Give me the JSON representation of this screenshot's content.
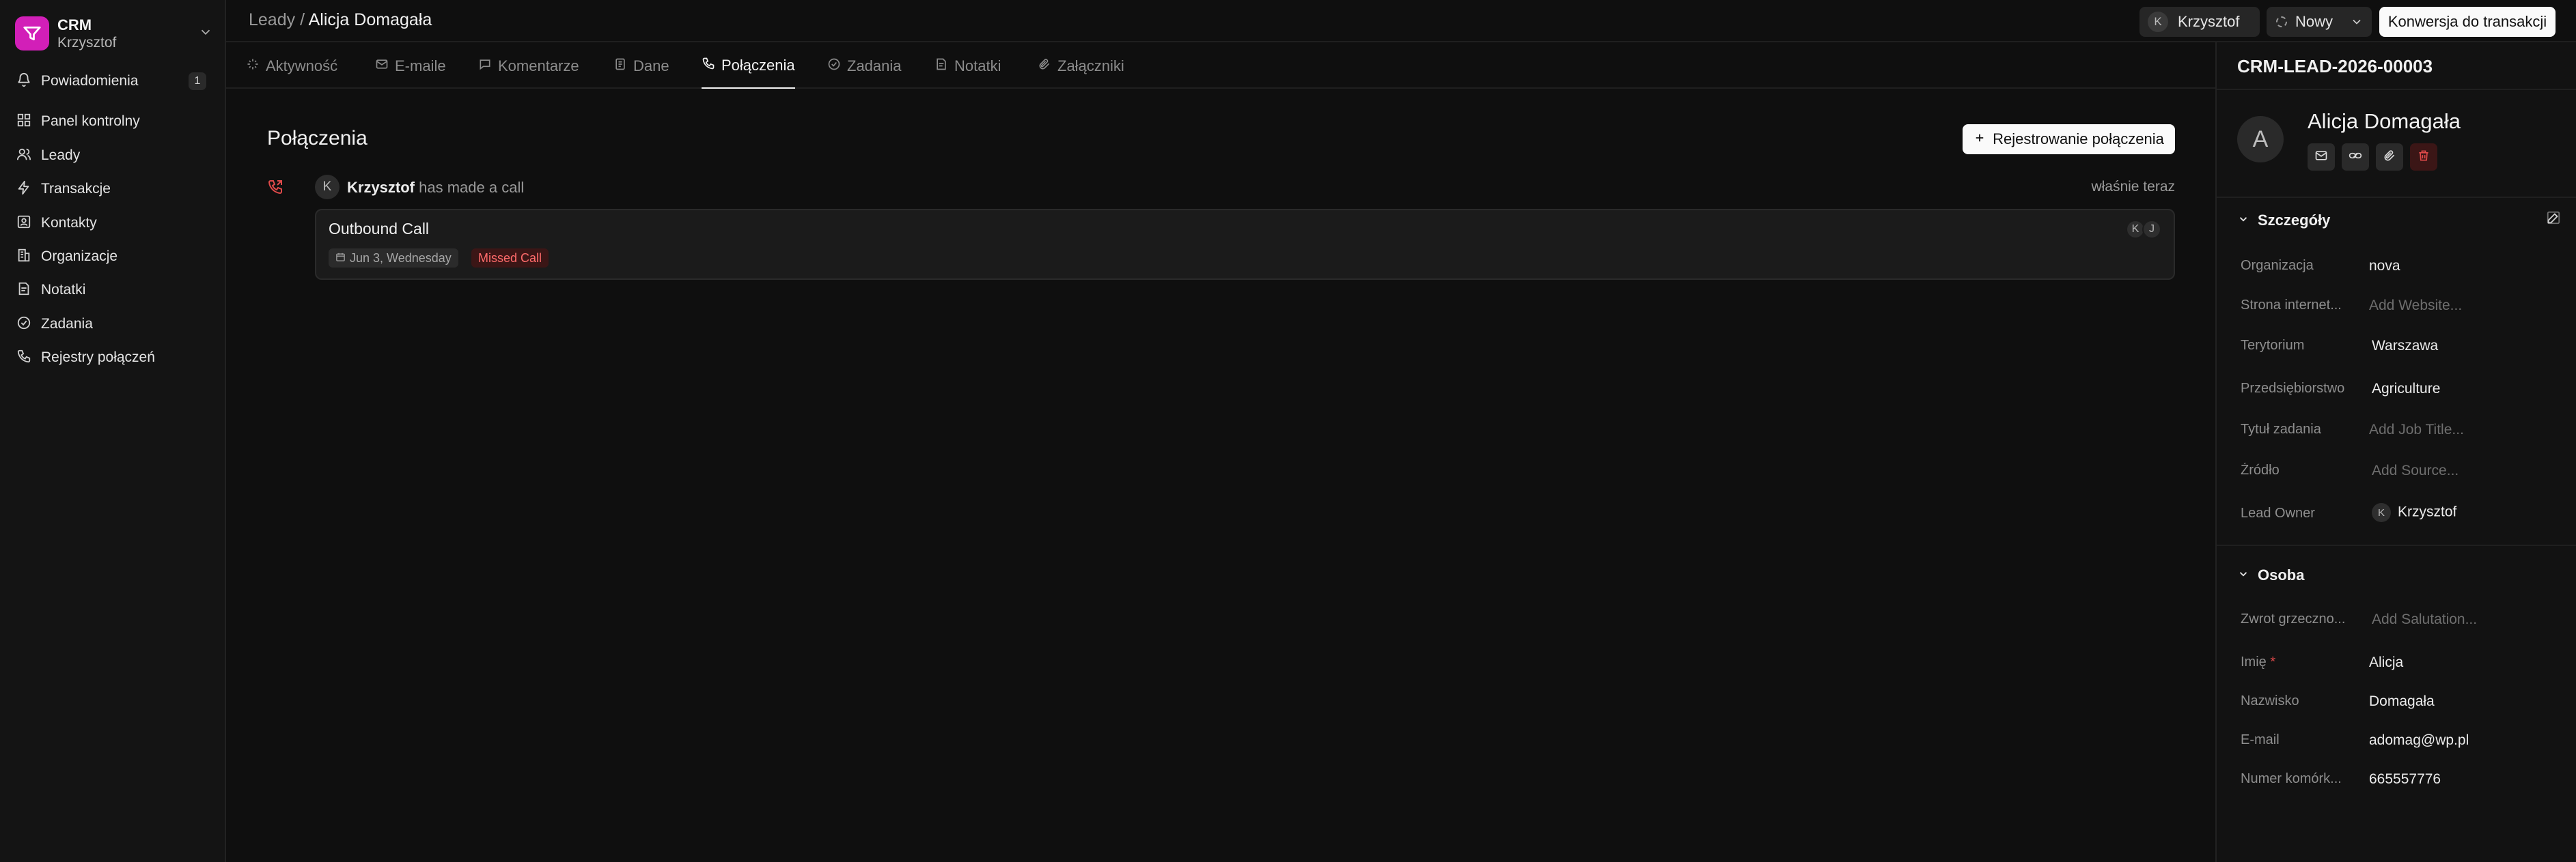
{
  "app": {
    "name": "CRM",
    "user": "Krzysztof"
  },
  "sidebar": {
    "items": [
      {
        "label": "Powiadomienia",
        "icon": "bell-icon",
        "badge": "1"
      },
      {
        "label": "Panel kontrolny",
        "icon": "dashboard-icon"
      },
      {
        "label": "Leady",
        "icon": "users-icon"
      },
      {
        "label": "Transakcje",
        "icon": "lightning-icon"
      },
      {
        "label": "Kontakty",
        "icon": "contact-icon"
      },
      {
        "label": "Organizacje",
        "icon": "building-icon"
      },
      {
        "label": "Notatki",
        "icon": "note-icon"
      },
      {
        "label": "Zadania",
        "icon": "check-circle-icon"
      },
      {
        "label": "Rejestry połączeń",
        "icon": "phone-icon"
      }
    ]
  },
  "breadcrumb": {
    "parent": "Leady",
    "separator": " / ",
    "current": "Alicja Domagała"
  },
  "header": {
    "user_initial": "K",
    "user_name": "Krzysztof",
    "status": "Nowy",
    "convert_label": "Konwersja do transakcji"
  },
  "tabs": [
    {
      "label": "Aktywność",
      "icon": "activity-icon"
    },
    {
      "label": "E-maile",
      "icon": "mail-icon"
    },
    {
      "label": "Komentarze",
      "icon": "comment-icon"
    },
    {
      "label": "Dane",
      "icon": "document-icon"
    },
    {
      "label": "Połączenia",
      "icon": "phone-icon",
      "active": true
    },
    {
      "label": "Zadania",
      "icon": "check-circle-icon"
    },
    {
      "label": "Notatki",
      "icon": "note-icon"
    },
    {
      "label": "Załączniki",
      "icon": "paperclip-icon"
    }
  ],
  "calls": {
    "title": "Połączenia",
    "log_button": "Rejestrowanie połączenia",
    "activity": {
      "initial": "K",
      "actor": "Krzysztof",
      "action": "has made a call",
      "time": "właśnie teraz",
      "card": {
        "title": "Outbound Call",
        "date": "Jun 3, Wednesday",
        "status": "Missed Call",
        "participants": [
          "K",
          "J"
        ]
      }
    }
  },
  "panel": {
    "lead_id": "CRM-LEAD-2026-00003",
    "avatar_initial": "A",
    "name": "Alicja Domagała",
    "details": {
      "title": "Szczegóły",
      "fields": [
        {
          "label": "Organizacja",
          "value": "nova"
        },
        {
          "label": "Strona internet...",
          "placeholder": "Add Website..."
        },
        {
          "label": "Terytorium",
          "value": "Warszawa"
        },
        {
          "label": "Przedsiębiorstwo",
          "value": "Agriculture"
        },
        {
          "label": "Tytuł zadania",
          "placeholder": "Add Job Title..."
        },
        {
          "label": "Źródło",
          "placeholder": "Add Source..."
        },
        {
          "label": "Lead Owner",
          "value": "Krzysztof",
          "initial": "K"
        }
      ]
    },
    "person": {
      "title": "Osoba",
      "fields": [
        {
          "label": "Zwrot grzeczno...",
          "placeholder": "Add Salutation..."
        },
        {
          "label": "Imię",
          "required_mark": "*",
          "value": "Alicja"
        },
        {
          "label": "Nazwisko",
          "value": "Domagała"
        },
        {
          "label": "E-mail",
          "value": "adomag@wp.pl"
        },
        {
          "label": "Numer komórk...",
          "value": "665557776"
        }
      ]
    }
  },
  "colors": {
    "accent": "#d21fb8",
    "missed": "#ff6b6b",
    "background": "#0f0f0f"
  }
}
